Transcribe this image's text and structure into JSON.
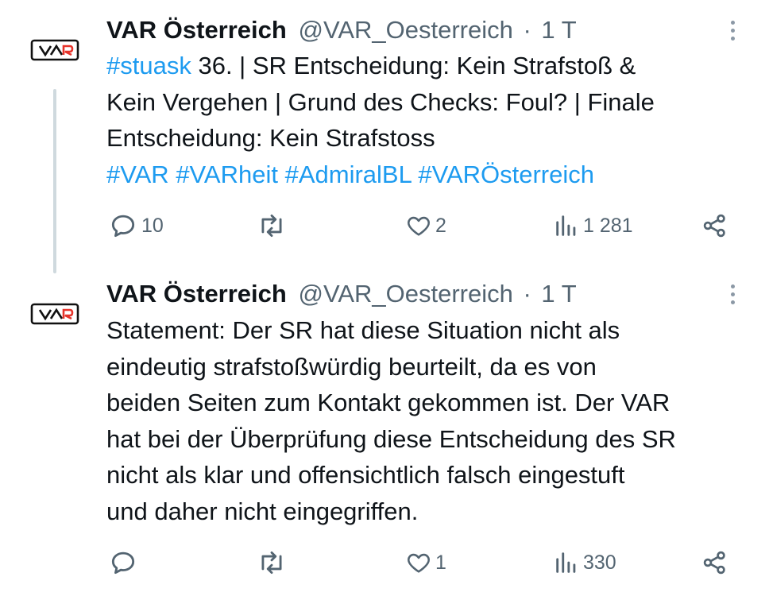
{
  "tweets": [
    {
      "display_name": "VAR Österreich",
      "handle": "@VAR_Oesterreich",
      "separator": "·",
      "time": "1 T",
      "body": [
        {
          "hashtag": "#stuask",
          "text": " 36. | SR Entscheidung: Kein Strafstoß &"
        },
        {
          "text": "Kein Vergehen | Grund des Checks: Foul? | Finale"
        },
        {
          "text": "Entscheidung: Kein Strafstoss"
        }
      ],
      "hashtags": [
        "#VAR",
        "#VARheit",
        "#AdmiralBL",
        "#VARÖsterreich"
      ],
      "stats": {
        "replies": "10",
        "retweets": "",
        "likes": "2",
        "views": "1 281"
      }
    },
    {
      "display_name": "VAR Österreich",
      "handle": "@VAR_Oesterreich",
      "separator": "·",
      "time": "1 T",
      "body": [
        {
          "text": "Statement: Der SR hat diese Situation nicht als"
        },
        {
          "text": "eindeutig strafstoßwürdig beurteilt, da es von"
        },
        {
          "text": "beiden Seiten zum Kontakt gekommen ist. Der VAR"
        },
        {
          "text": "hat bei der Überprüfung diese Entscheidung des SR"
        },
        {
          "text": "nicht als klar und offensichtlich falsch eingestuft"
        },
        {
          "text": "und daher nicht eingegriffen."
        }
      ],
      "stats": {
        "replies": "",
        "retweets": "",
        "likes": "1",
        "views": "330"
      }
    }
  ],
  "avatar_logo_text": "VAR",
  "icons": {
    "reply": "reply-icon",
    "retweet": "retweet-icon",
    "like": "heart-icon",
    "views": "views-icon",
    "share": "share-icon",
    "more": "more-options-icon"
  },
  "colors": {
    "accent": "#1d9bf0",
    "text": "#0f1419",
    "secondary": "#536471",
    "logo_red": "#e6332a"
  }
}
